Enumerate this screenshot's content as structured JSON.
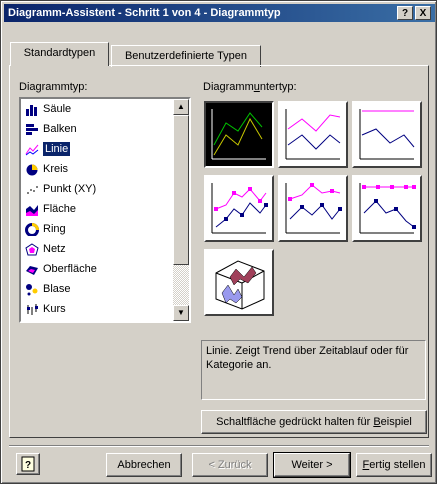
{
  "window": {
    "title": "Diagramm-Assistent - Schritt 1 von 4 - Diagrammtyp",
    "help_btn": "?",
    "close_btn": "X"
  },
  "tabs": [
    {
      "label": "Standardtypen",
      "active": true
    },
    {
      "label": "Benutzerdefinierte Typen",
      "active": false
    }
  ],
  "chart_type_label": "Diagrammtyp:",
  "chart_types": [
    {
      "label": "Säule",
      "icon": "column-chart-icon"
    },
    {
      "label": "Balken",
      "icon": "bar-chart-icon"
    },
    {
      "label": "Linie",
      "icon": "line-chart-icon",
      "selected": true
    },
    {
      "label": "Kreis",
      "icon": "pie-chart-icon"
    },
    {
      "label": "Punkt (XY)",
      "icon": "scatter-chart-icon"
    },
    {
      "label": "Fläche",
      "icon": "area-chart-icon"
    },
    {
      "label": "Ring",
      "icon": "doughnut-chart-icon"
    },
    {
      "label": "Netz",
      "icon": "radar-chart-icon"
    },
    {
      "label": "Oberfläche",
      "icon": "surface-chart-icon"
    },
    {
      "label": "Blase",
      "icon": "bubble-chart-icon"
    },
    {
      "label": "Kurs",
      "icon": "stock-chart-icon"
    }
  ],
  "subtype_label_pre": "Diagramm",
  "subtype_label_u": "u",
  "subtype_label_post": "ntertyp:",
  "description": "Linie. Zeigt Trend über Zeitablauf oder für Kategorie an.",
  "preview_button_pre": "Schaltfläche gedrückt halten für ",
  "preview_button_u": "B",
  "preview_button_post": "eispiel",
  "buttons": {
    "cancel": "Abbrechen",
    "back": "< Zurück",
    "next": "Weiter >",
    "finish_u": "F",
    "finish_rest": "ertig stellen"
  },
  "colors": {
    "title_gradient_start": "#0a246a",
    "selection": "#0a246a",
    "line_magenta": "#ff00ff",
    "line_navy": "#000080"
  }
}
